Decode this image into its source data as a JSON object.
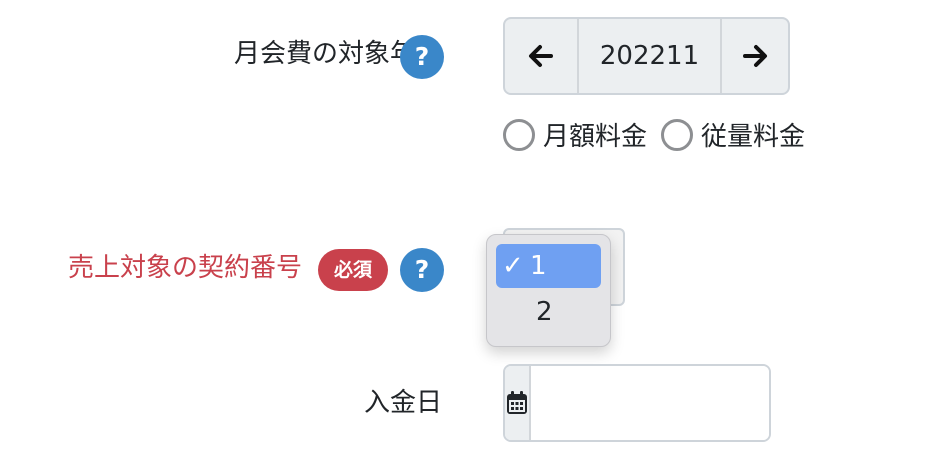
{
  "monthly_fee": {
    "label": "月会費の対象年月",
    "help_icon": "?",
    "period_value": "202211",
    "prev_icon": "arrow-left-icon",
    "next_icon": "arrow-right-icon",
    "radio_options": [
      "月額料金",
      "従量料金"
    ]
  },
  "contract": {
    "label": "売上対象の契約番号",
    "required_badge": "必須",
    "help_icon": "?",
    "dropdown": {
      "checkmark": "✓",
      "options": [
        "1",
        "2"
      ],
      "selected": "1"
    }
  },
  "payment_date": {
    "label": "入金日",
    "calendar_icon": "calendar-icon",
    "value": ""
  },
  "colors": {
    "required_label": "#c9414c",
    "help_badge": "#3a87c9",
    "required_badge": "#c9414c",
    "selected_option": "#6fa0f2"
  }
}
